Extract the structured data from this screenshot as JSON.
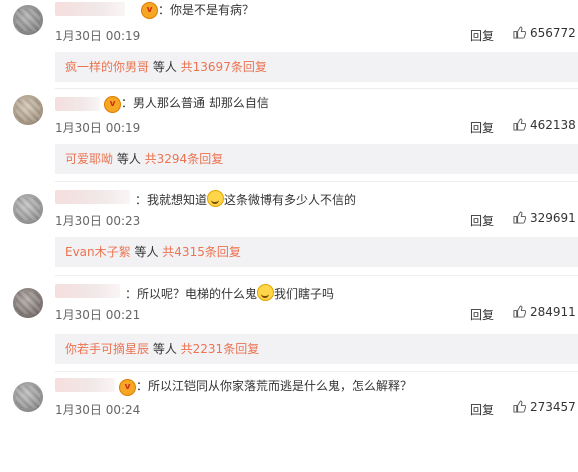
{
  "comments": [
    {
      "text_before": "：你是不是有病？",
      "text_after": "",
      "time": "1月30日 00:19",
      "reply_label": "回复",
      "likes": "656772",
      "sub": {
        "name": "疯一样的你男哥",
        "middle": " 等人 ",
        "count": "共13697条回复"
      }
    },
    {
      "text_before": "：男人那么普通 却那么自信",
      "text_after": "",
      "time": "1月30日 00:19",
      "reply_label": "回复",
      "likes": "462138",
      "sub": {
        "name": "可爱耶呦",
        "middle": " 等人 ",
        "count": "共3294条回复"
      }
    },
    {
      "text_before": "：我就想知道",
      "text_after": "这条微博有多少人不信的",
      "time": "1月30日 00:23",
      "reply_label": "回复",
      "likes": "329691",
      "sub": {
        "name": "Evan木子絮",
        "middle": " 等人 ",
        "count": "共4315条回复"
      }
    },
    {
      "text_before": "：所以呢？电梯的什么鬼",
      "text_after": "我们瞎子吗",
      "time": "1月30日 00:21",
      "reply_label": "回复",
      "likes": "284911",
      "sub": {
        "name": "你若手可摘星辰",
        "middle": " 等人 ",
        "count": "共2231条回复"
      }
    },
    {
      "text_before": "：所以江铠同从你家落荒而逃是什么鬼，怎么解释？",
      "text_after": "",
      "time": "1月30日 00:24",
      "reply_label": "回复",
      "likes": "273457"
    }
  ],
  "icons": {
    "thumb": "thumbs-up-icon",
    "emoji": "smile-emoji-icon",
    "badge": "vip-badge-icon"
  },
  "colors": {
    "link": "#eb7350",
    "subreply_bg": "#f2f2f5",
    "text": "#333333",
    "meta": "#666666"
  }
}
